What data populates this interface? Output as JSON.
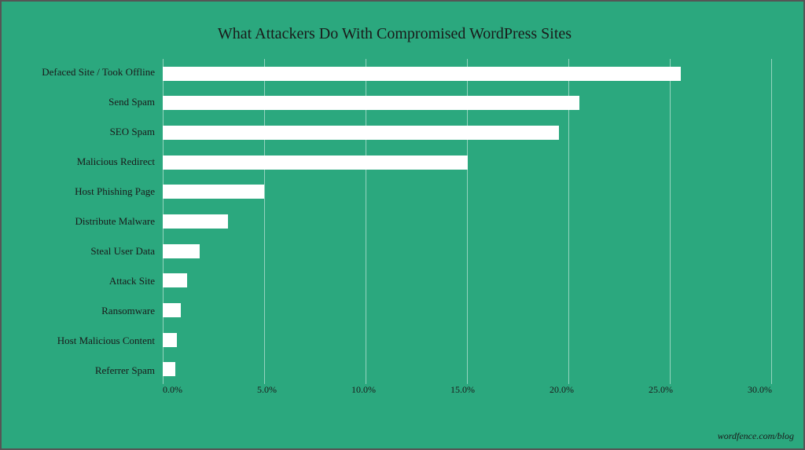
{
  "chart": {
    "title": "What Attackers Do With Compromised WordPress Sites",
    "attribution": "wordfence.com/blog",
    "bars": [
      {
        "label": "Defaced Site / Took Offline",
        "value": 25.5,
        "pct": 25.5
      },
      {
        "label": "Send Spam",
        "value": 20.5,
        "pct": 20.5
      },
      {
        "label": "SEO Spam",
        "value": 19.5,
        "pct": 19.5
      },
      {
        "label": "Malicious Redirect",
        "value": 15.0,
        "pct": 15.0
      },
      {
        "label": "Host Phishing Page",
        "value": 5.0,
        "pct": 5.0
      },
      {
        "label": "Distribute Malware",
        "value": 3.2,
        "pct": 3.2
      },
      {
        "label": "Steal User Data",
        "value": 1.8,
        "pct": 1.8
      },
      {
        "label": "Attack Site",
        "value": 1.2,
        "pct": 1.2
      },
      {
        "label": "Ransomware",
        "value": 0.9,
        "pct": 0.9
      },
      {
        "label": "Host Malicious Content",
        "value": 0.7,
        "pct": 0.7
      },
      {
        "label": "Referrer Spam",
        "value": 0.6,
        "pct": 0.6
      }
    ],
    "x_axis": {
      "labels": [
        "0.0%",
        "5.0%",
        "10.0%",
        "15.0%",
        "20.0%",
        "25.0%",
        "30.0%"
      ],
      "max": 30
    }
  }
}
